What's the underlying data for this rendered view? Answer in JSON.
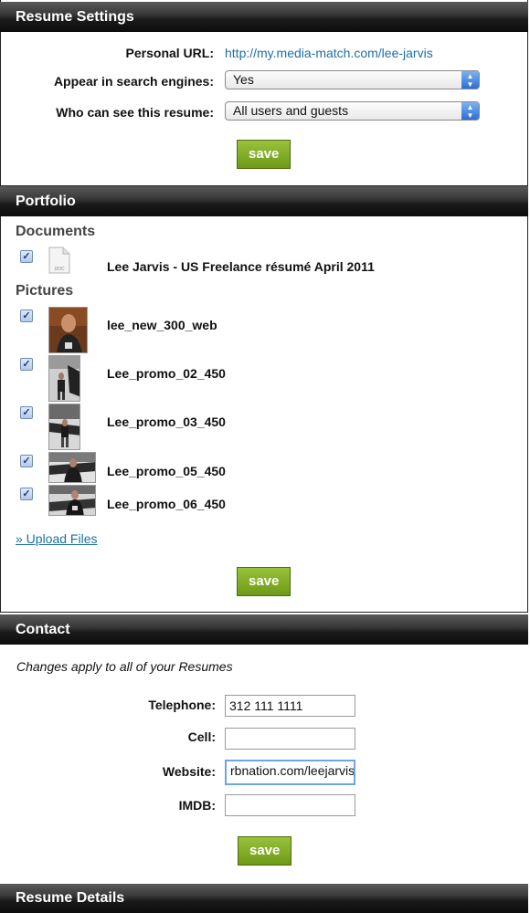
{
  "resume_settings": {
    "header": "Resume Settings",
    "personal_url_label": "Personal URL:",
    "personal_url": "http://my.media-match.com/lee-jarvis",
    "search_engines_label": "Appear in search engines:",
    "search_engines_value": "Yes",
    "visibility_label": "Who can see this resume:",
    "visibility_value": "All users and guests",
    "save_label": "save"
  },
  "portfolio": {
    "header": "Portfolio",
    "documents_title": "Documents",
    "documents": [
      {
        "name": "Lee Jarvis - US Freelance résumé April 2011",
        "icon_text": "DOC",
        "checked": true
      }
    ],
    "pictures_title": "Pictures",
    "pictures": [
      {
        "name": "lee_new_300_web",
        "checked": true
      },
      {
        "name": "Lee_promo_02_450",
        "checked": true
      },
      {
        "name": "Lee_promo_03_450",
        "checked": true
      },
      {
        "name": "Lee_promo_05_450",
        "checked": true
      },
      {
        "name": "Lee_promo_06_450",
        "checked": true
      }
    ],
    "upload_label": "» Upload Files",
    "save_label": "save"
  },
  "contact": {
    "header": "Contact",
    "note": "Changes apply to all of your Resumes",
    "telephone_label": "Telephone:",
    "telephone_value": "312 111 1111",
    "cell_label": "Cell:",
    "cell_value": "",
    "website_label": "Website:",
    "website_value": "rbnation.com/leejarvis",
    "imdb_label": "IMDB:",
    "imdb_value": "",
    "save_label": "save"
  },
  "resume_details": {
    "header": "Resume Details"
  },
  "colors": {
    "link": "#1d6fa5",
    "save_button": "#7ea824",
    "header_bg": "#1a1a1a"
  }
}
